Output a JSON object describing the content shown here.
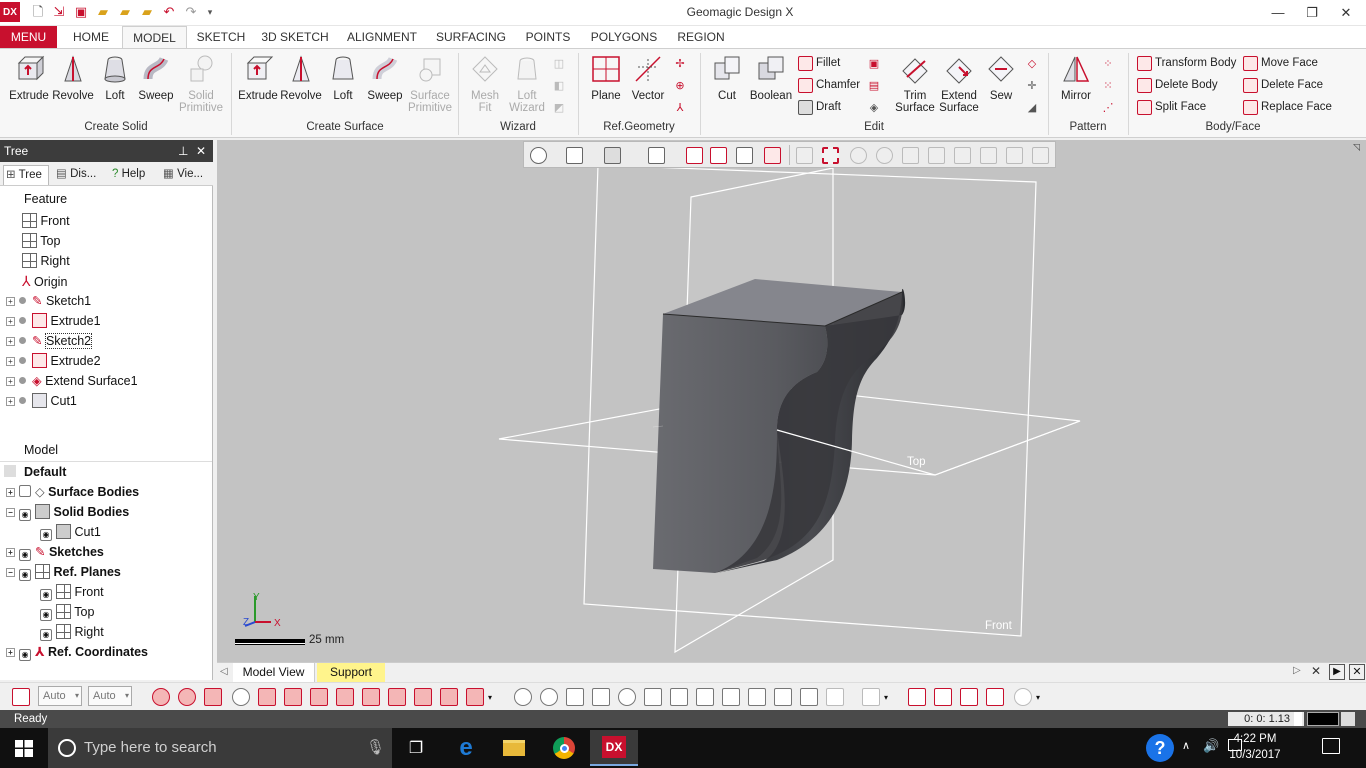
{
  "title_bar": {
    "app_logo": "DX",
    "window_title": "Geomagic Design X",
    "quick_access_icons": [
      "new-icon",
      "open-icon",
      "save-icon",
      "import-icon",
      "open-folder-icon",
      "export-icon",
      "undo-icon",
      "redo-icon",
      "customize-icon"
    ],
    "window_controls": {
      "minimize": "—",
      "restore": "❐",
      "close": "✕"
    }
  },
  "tabs": [
    "MENU",
    "HOME",
    "MODEL",
    "SKETCH",
    "3D SKETCH",
    "ALIGNMENT",
    "SURFACING",
    "POINTS",
    "POLYGONS",
    "REGION"
  ],
  "active_tab": "MODEL",
  "ribbon": {
    "create_solid": {
      "label": "Create Solid",
      "buttons": [
        "Extrude",
        "Revolve",
        "Loft",
        "Sweep",
        "Solid Primitive"
      ]
    },
    "create_surface": {
      "label": "Create Surface",
      "buttons": [
        "Extrude",
        "Revolve",
        "Loft",
        "Sweep",
        "Surface Primitive"
      ]
    },
    "wizard": {
      "label": "Wizard",
      "buttons": [
        "Mesh Fit",
        "Loft Wizard"
      ]
    },
    "ref_geometry": {
      "label": "Ref.Geometry",
      "buttons": [
        "Plane",
        "Vector"
      ]
    },
    "edit": {
      "label": "Edit",
      "buttons": [
        "Cut",
        "Boolean"
      ],
      "small_buttons": [
        "Fillet",
        "Chamfer",
        "Draft"
      ],
      "buttons2": [
        "Trim Surface",
        "Extend Surface",
        "Sew"
      ]
    },
    "pattern": {
      "label": "Pattern",
      "buttons": [
        "Mirror"
      ]
    },
    "body_face": {
      "label": "Body/Face",
      "small_buttons": [
        "Transform Body",
        "Delete Body",
        "Split Face",
        "Move Face",
        "Delete Face",
        "Replace Face"
      ]
    }
  },
  "left_panel": {
    "title": "Tree",
    "tabs": [
      "Tree",
      "Dis...",
      "Help",
      "Vie..."
    ],
    "feature_header": "Feature",
    "features": [
      "Front",
      "Top",
      "Right",
      "Origin",
      "Sketch1",
      "Extrude1",
      "Sketch2",
      "Extrude2",
      "Extend Surface1",
      "Cut1"
    ],
    "model_header": "Model",
    "model_tree": [
      "Default",
      "Surface Bodies",
      "Solid Bodies",
      "Cut1",
      "Sketches",
      "Ref. Planes",
      "Front",
      "Top",
      "Right",
      "Ref. Coordinates"
    ]
  },
  "viewport": {
    "plane_labels": {
      "top": "Top",
      "front": "Front"
    },
    "axis": {
      "x": "X",
      "y": "Y",
      "z": "Z"
    },
    "scale_label": "25 mm",
    "colors": {
      "background": "#c3c3c3",
      "body_dark": "#3f4045",
      "body_top": "#85868d",
      "plane_line": "#ffffff",
      "accent": "#c8102e"
    }
  },
  "bottom_tabs": [
    "Model View",
    "Support"
  ],
  "bottom_toolbar": {
    "auto1": "Auto",
    "auto2": "Auto"
  },
  "status": {
    "text": "Ready",
    "time_readout": "0: 0: 1.13"
  },
  "taskbar": {
    "search_placeholder": "Type here to search",
    "time": "4:22 PM",
    "date": "10/3/2017"
  }
}
